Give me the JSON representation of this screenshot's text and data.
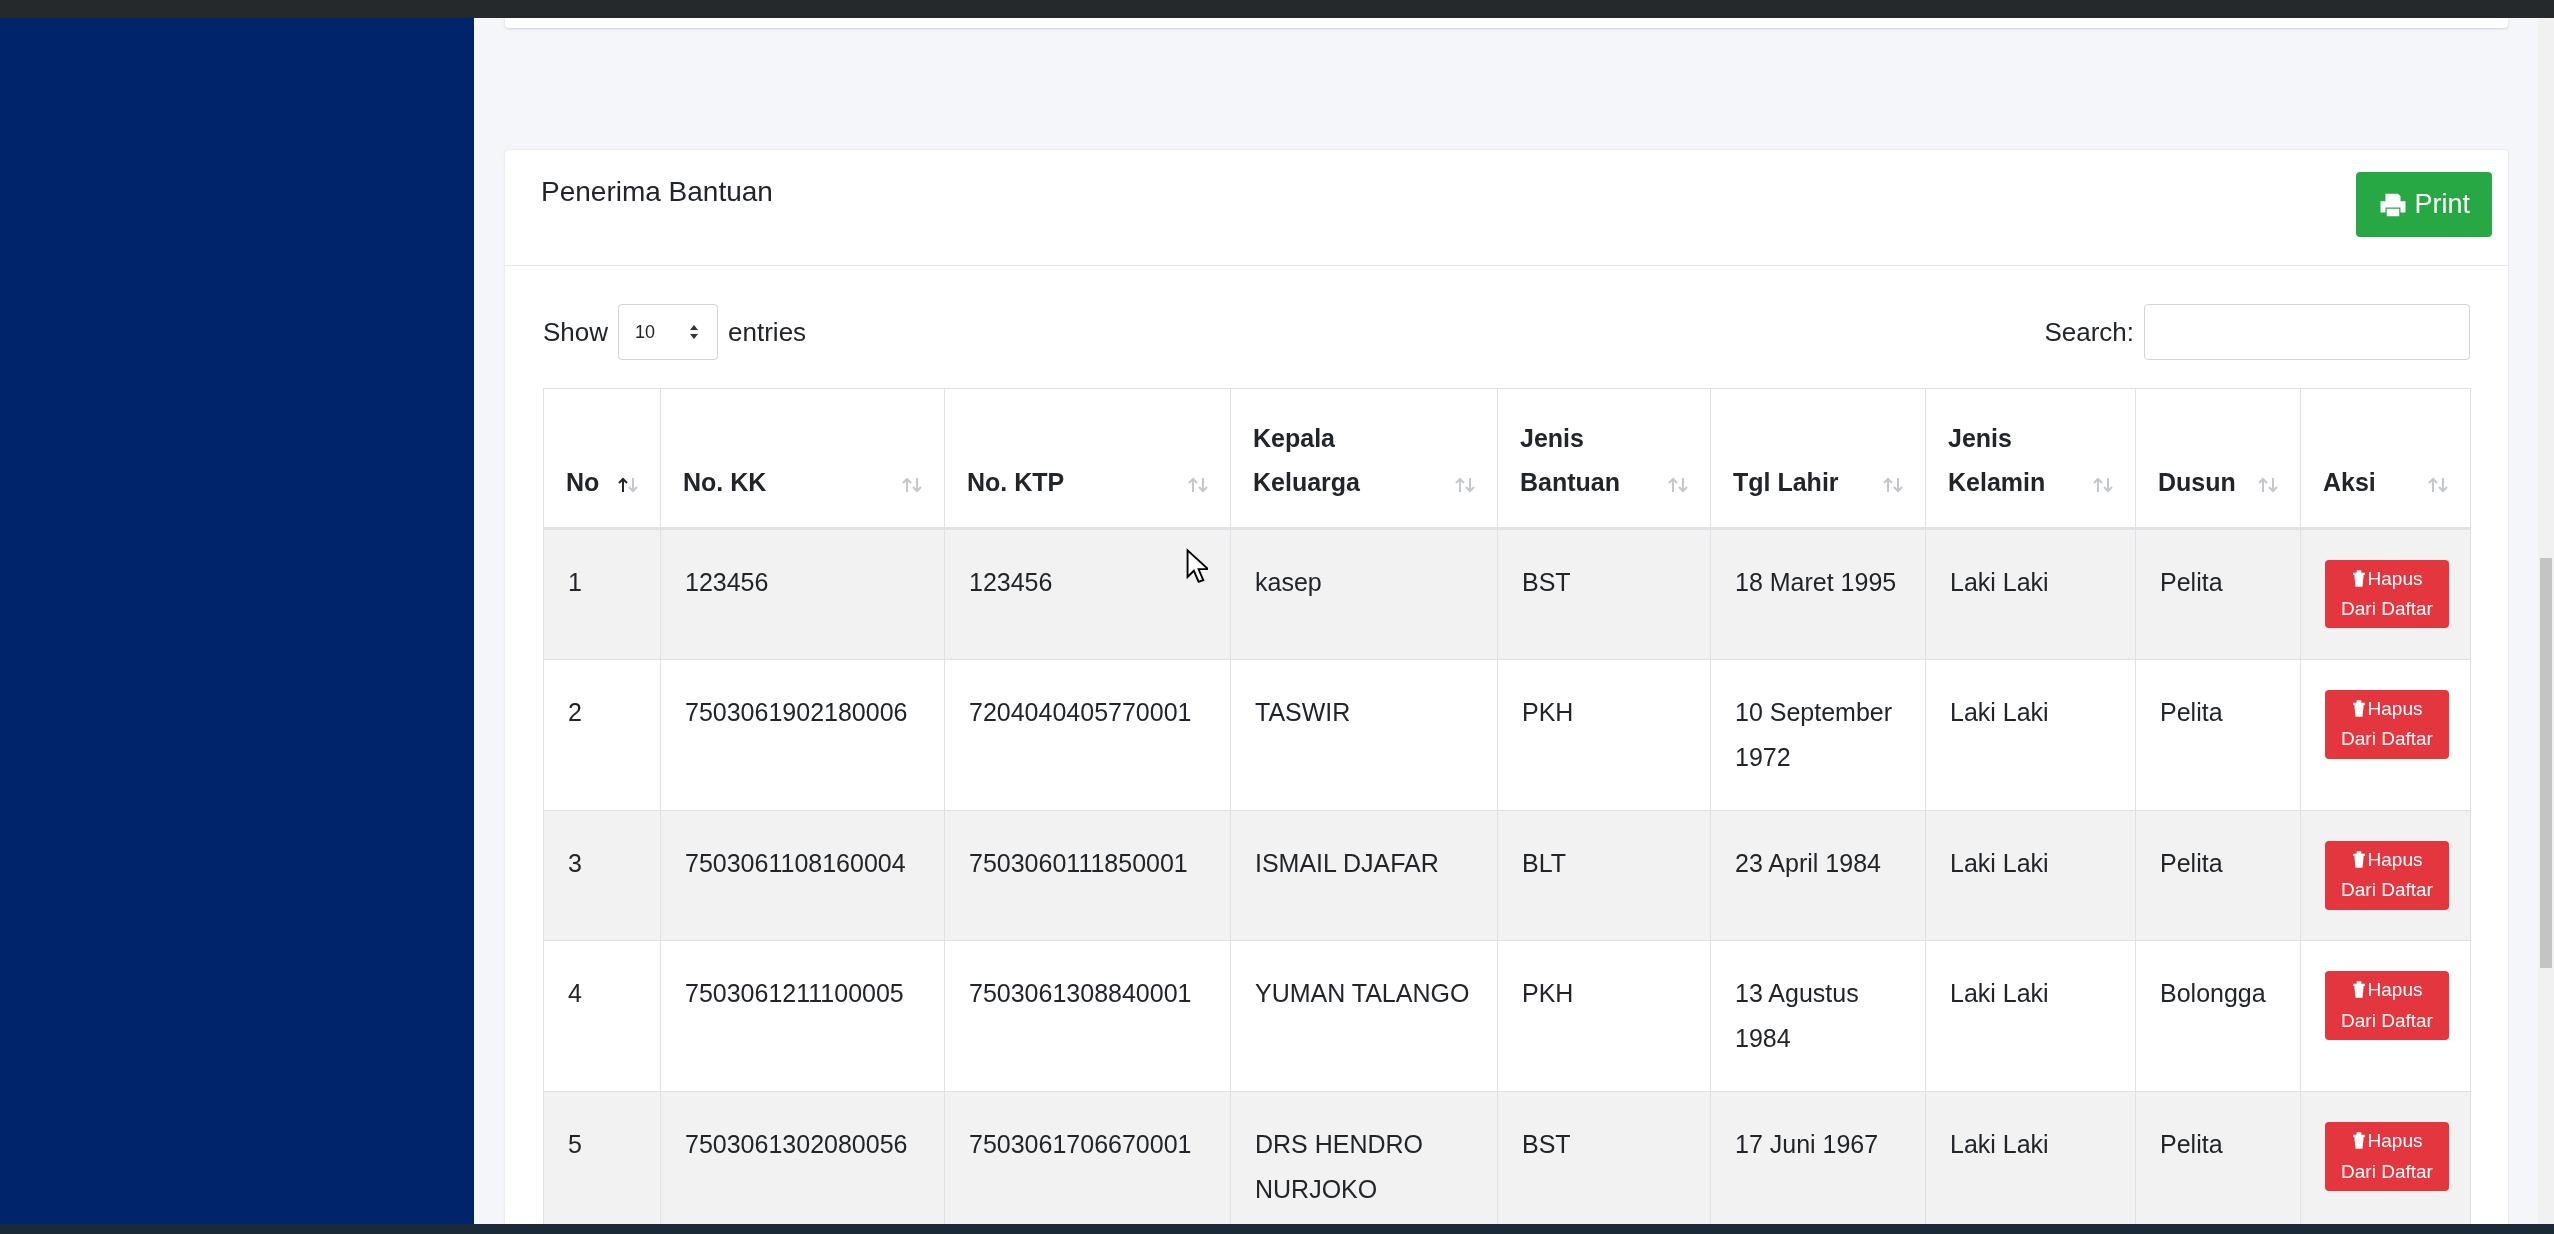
{
  "card": {
    "title": "Penerima Bantuan",
    "print_button": "Print"
  },
  "length_control": {
    "show": "Show",
    "value": "10",
    "entries": "entries"
  },
  "search": {
    "label": "Search:"
  },
  "table": {
    "columns": [
      {
        "label": "No",
        "sorted": true
      },
      {
        "label": "No. KK",
        "sorted": false
      },
      {
        "label": "No. KTP",
        "sorted": false
      },
      {
        "label": "Kepala Keluarga",
        "sorted": false
      },
      {
        "label": "Jenis Bantuan",
        "sorted": false
      },
      {
        "label": "Tgl Lahir",
        "sorted": false
      },
      {
        "label": "Jenis Kelamin",
        "sorted": false
      },
      {
        "label": "Dusun",
        "sorted": false
      },
      {
        "label": "Aksi",
        "sorted": false
      }
    ],
    "rows": [
      {
        "cells": [
          "1",
          "123456",
          "123456",
          "kasep",
          "BST",
          "18 Maret 1995",
          "Laki Laki",
          "Pelita"
        ],
        "action": "Hapus Dari Daftar"
      },
      {
        "cells": [
          "2",
          "7503061902180006",
          "7204040405770001",
          "TASWIR",
          "PKH",
          "10 September 1972",
          "Laki Laki",
          "Pelita"
        ],
        "action": "Hapus Dari Daftar"
      },
      {
        "cells": [
          "3",
          "7503061108160004",
          "7503060111850001",
          "ISMAIL DJAFAR",
          "BLT",
          "23 April 1984",
          "Laki Laki",
          "Pelita"
        ],
        "action": "Hapus Dari Daftar"
      },
      {
        "cells": [
          "4",
          "7503061211100005",
          "7503061308840001",
          "YUMAN TALANGO",
          "PKH",
          "13 Agustus 1984",
          "Laki Laki",
          "Bolongga"
        ],
        "action": "Hapus Dari Daftar"
      },
      {
        "cells": [
          "5",
          "7503061302080056",
          "7503061706670001",
          "DRS HENDRO NURJOKO",
          "BST",
          "17 Juni 1967",
          "Laki Laki",
          "Pelita"
        ],
        "action": "Hapus Dari Daftar"
      }
    ]
  }
}
